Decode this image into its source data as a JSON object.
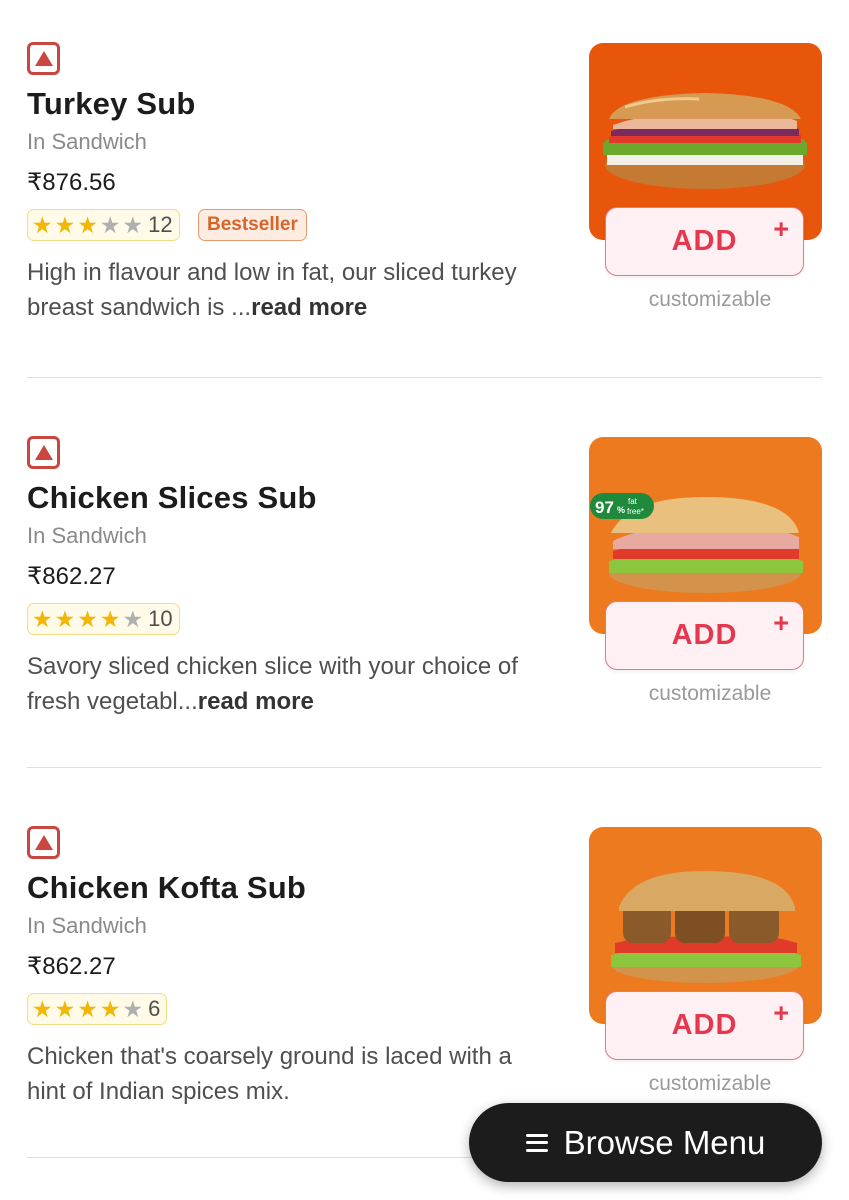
{
  "items": [
    {
      "name": "Turkey Sub",
      "category": "In Sandwich",
      "price": "₹876.56",
      "rating_stars": 3,
      "rating_count": "12",
      "bestseller": "Bestseller",
      "description": "High in flavour and low in fat, our sliced turkey breast sandwich is ...",
      "read_more": "read more",
      "add_label": "ADD",
      "add_plus": "+",
      "customizable": "customizable",
      "image_bg": "#e8560c"
    },
    {
      "name": "Chicken Slices Sub",
      "category": "In Sandwich",
      "price": "₹862.27",
      "rating_stars": 4,
      "rating_count": "10",
      "description": "Savory sliced chicken slice with your choice of fresh vegetabl...",
      "read_more": "read more",
      "add_label": "ADD",
      "add_plus": "+",
      "customizable": "customizable",
      "image_bg": "#ee7a1f",
      "badge_big": "97",
      "badge_unit": "%",
      "badge_text_1": "fat",
      "badge_text_2": "free*"
    },
    {
      "name": "Chicken Kofta Sub",
      "category": "In Sandwich",
      "price": "₹862.27",
      "rating_stars": 4,
      "rating_count": "6",
      "description": "Chicken that's coarsely ground is laced with a hint of Indian spices mix.",
      "add_label": "ADD",
      "add_plus": "+",
      "customizable": "customizable",
      "image_bg": "#ee7a1f"
    }
  ],
  "browse_menu": {
    "label": "Browse Menu",
    "icon": "hamburger-menu-icon"
  },
  "colors": {
    "accent": "#e5374e",
    "nonveg": "#c9473f",
    "star_on": "#f2b705",
    "star_off": "#b0b0b0",
    "bestseller": "#d7652b"
  }
}
